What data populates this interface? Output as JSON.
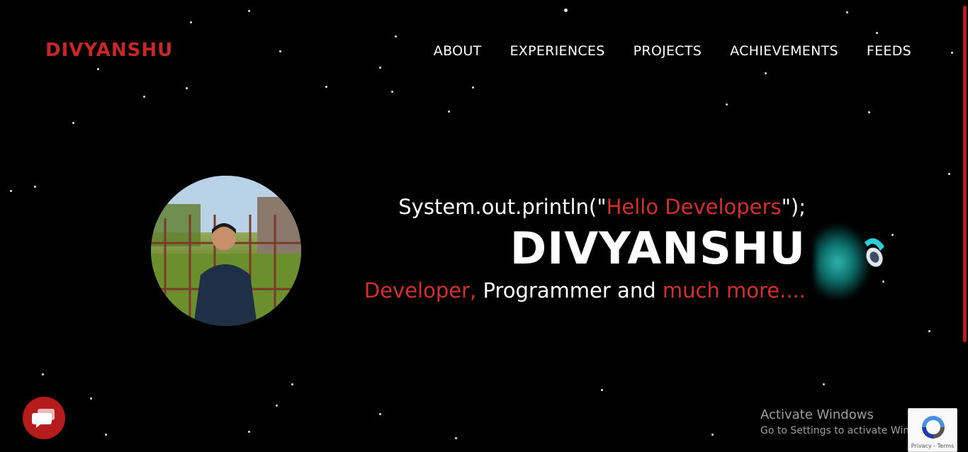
{
  "nav": {
    "logo": "DIVYANSHU",
    "items": [
      "ABOUT",
      "EXPERIENCES",
      "PROJECTS",
      "ACHIEVEMENTS",
      "FEEDS"
    ]
  },
  "hero": {
    "code_prefix": "System.out.println(\"",
    "code_string": "Hello Developers",
    "code_suffix": "\");",
    "name": "DIVYANSHU",
    "tag_red1": "Developer,",
    "tag_white": " Programmer and ",
    "tag_red2": "much more....",
    "avatar_icon": "profile-photo"
  },
  "windows_notice": {
    "title": "Activate Windows",
    "subtitle": "Go to Settings to activate Windows."
  },
  "recaptcha": {
    "terms": "Privacy - Terms"
  },
  "icons": {
    "chat": "chat-icon",
    "rocket": "rocket-icon",
    "recaptcha": "recaptcha-icon"
  },
  "colors": {
    "accent": "#d32f2f",
    "background": "#000000",
    "glow": "#2fb7b0"
  }
}
